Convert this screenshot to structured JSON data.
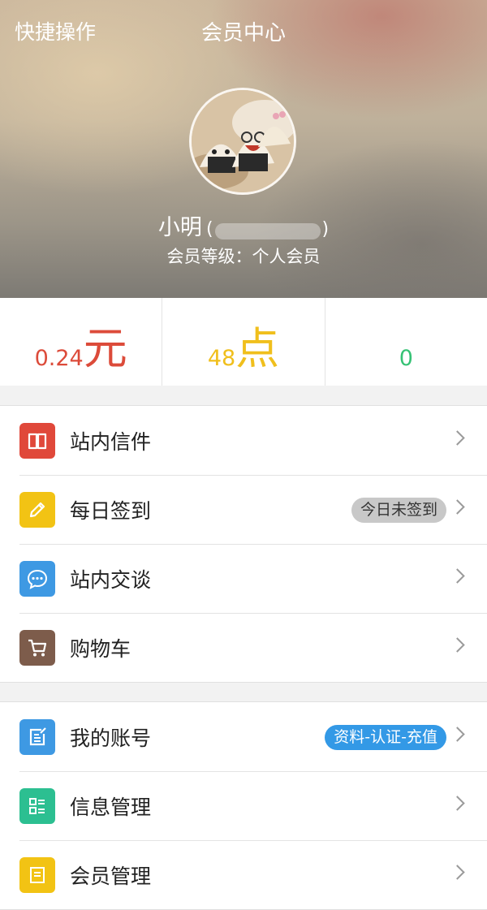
{
  "header": {
    "quick_ops": "快捷操作",
    "title": "会员中心",
    "username": "小明",
    "paren_open": "(",
    "paren_close": ")",
    "member_level": "会员等级：个人会员"
  },
  "stats": [
    {
      "value": "0.24",
      "unit": "元",
      "color": "#dc4b3a"
    },
    {
      "value": "48",
      "unit": "点",
      "color": "#f0bf1c"
    },
    {
      "value": "0",
      "unit": "",
      "color": "#36c275"
    }
  ],
  "menu_group_1": [
    {
      "label": "站内信件",
      "icon": "book-icon",
      "icon_color": "#e0483a"
    },
    {
      "label": "每日签到",
      "icon": "pencil-icon",
      "icon_color": "#f2c314",
      "badge": "今日未签到"
    },
    {
      "label": "站内交谈",
      "icon": "chat-bubble-icon",
      "icon_color": "#3e99e3"
    },
    {
      "label": "购物车",
      "icon": "cart-icon",
      "icon_color": "#7d5c4b"
    }
  ],
  "menu_group_2": [
    {
      "label": "我的账号",
      "icon": "edit-document-icon",
      "icon_color": "#3e99e3",
      "badge": "资料-认证-充值"
    },
    {
      "label": "信息管理",
      "icon": "list-grid-icon",
      "icon_color": "#2cbf91"
    },
    {
      "label": "会员管理",
      "icon": "document-icon",
      "icon_color": "#f2c314"
    }
  ]
}
